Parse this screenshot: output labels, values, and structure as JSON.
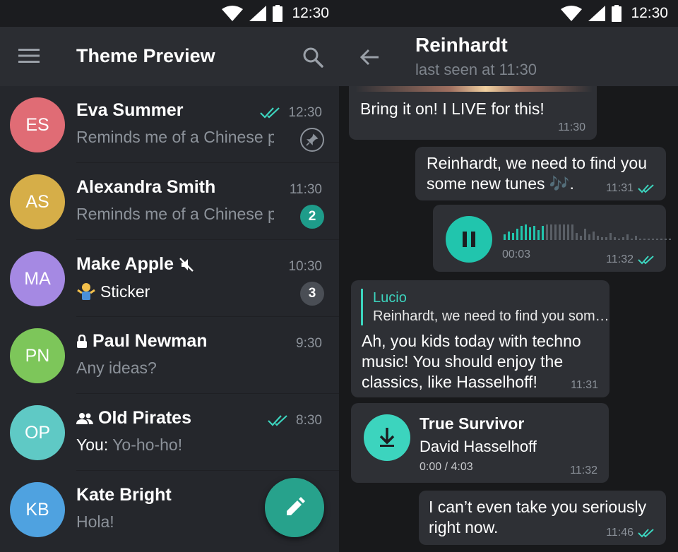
{
  "status_bar": {
    "time": "12:30"
  },
  "left": {
    "title": "Theme Preview",
    "chats": [
      {
        "initials": "ES",
        "color": "#e06c75",
        "name": "Eva Summer",
        "time": "12:30",
        "preview": "Reminds me of a Chinese prove",
        "read": true,
        "pinned": true
      },
      {
        "initials": "AS",
        "color": "#d6ae48",
        "name": "Alexandra Smith",
        "time": "11:30",
        "preview": "Reminds me of a Chinese prove",
        "badge": "2"
      },
      {
        "initials": "MA",
        "color": "#a589e3",
        "name": "Make Apple",
        "time": "10:30",
        "preview": "Sticker",
        "badge": "3",
        "muted": true
      },
      {
        "initials": "PN",
        "color": "#7dc65a",
        "name": "Paul Newman",
        "time": "9:30",
        "preview": "Any ideas?",
        "secret": true
      },
      {
        "initials": "OP",
        "color": "#5fc9c5",
        "name": "Old Pirates",
        "time": "8:30",
        "preview_prefix": "You:",
        "preview": "Yo-ho-ho!",
        "read": true,
        "group": true
      },
      {
        "initials": "KB",
        "color": "#4fa2e0",
        "name": "Kate Bright",
        "time": "",
        "preview": "Hola!"
      }
    ],
    "colors": {
      "unread_badge": "#1e9c8a",
      "muted_badge": "#4a4e55",
      "read_check": "#3cd4be"
    }
  },
  "right": {
    "contact_name": "Reinhardt",
    "contact_status": "last seen at 11:30",
    "messages": {
      "m1": {
        "text": "Bring it on! I LIVE for this!",
        "time": "11:30"
      },
      "m2": {
        "text1": "Reinhardt, we need to find you",
        "text2": "some new tunes 🎶.",
        "time": "11:31"
      },
      "m3": {
        "duration": "00:03",
        "time": "11:32"
      },
      "m4": {
        "reply_name": "Lucio",
        "reply_text": "Reinhardt, we need to find you som…",
        "text1": "Ah, you kids today with techno",
        "text2": "music! You should enjoy the",
        "text3": "classics, like Hasselhoff!",
        "time": "11:31"
      },
      "m5": {
        "title": "True Survivor",
        "artist": "David Hasselhoff",
        "progress": "0:00 / 4:03",
        "time": "11:32"
      },
      "m6": {
        "text1": "I can’t even take you seriously",
        "text2": "right now.",
        "time": "11:46"
      }
    }
  }
}
